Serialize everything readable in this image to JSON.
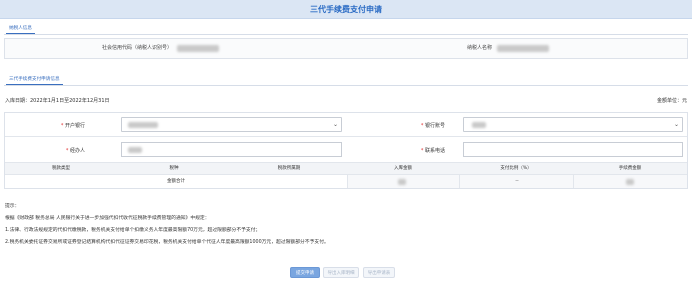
{
  "page": {
    "title": "三代手续费支付申请"
  },
  "taxpayer_section": {
    "tab": "纳税人信息",
    "credit_code_label": "社会信用代码（纳税人识别号）",
    "taxpayer_name_label": "纳税人名称"
  },
  "application_section": {
    "tab": "三代手续费支付申请信息",
    "period": "入库日期：2022年1月1日至2022年12月31日",
    "unit": "金额单位：元",
    "fields": {
      "bank_label": "开户银行",
      "account_label": "银行账号",
      "agent_label": "经办人",
      "phone_label": "联系电话"
    },
    "table": {
      "headers": [
        "税款类型",
        "税种",
        "税款所属期",
        "入库金额",
        "支付比例（%）",
        "手续费金额"
      ],
      "total_label": "金额合计",
      "total_ratio": "--"
    }
  },
  "notes": {
    "title": "提示：",
    "line1": "根据《财政部 税务总局 人民银行关于进一步加强代扣代收代征税款手续费管理的通知》中规定：",
    "line2": "1.法律、行政法规规定的代扣代缴税款，税务机关支付给单个扣缴义务人年度最高限额70万元，超过限额部分不予支付；",
    "line3": "2.税务机关委托证券交易所或证券登记结算机构代扣代征证券交易印花税，税务机关支付给单个代征人年度最高限额1000万元，超过限额部分不予支付。"
  },
  "buttons": {
    "submit": "提交申请",
    "proof": "导出入库明细",
    "export": "导出申请表"
  },
  "colors": {
    "accent": "#2a6bc4",
    "required": "#e02b2b",
    "header_bg": "#dbe6f4"
  }
}
